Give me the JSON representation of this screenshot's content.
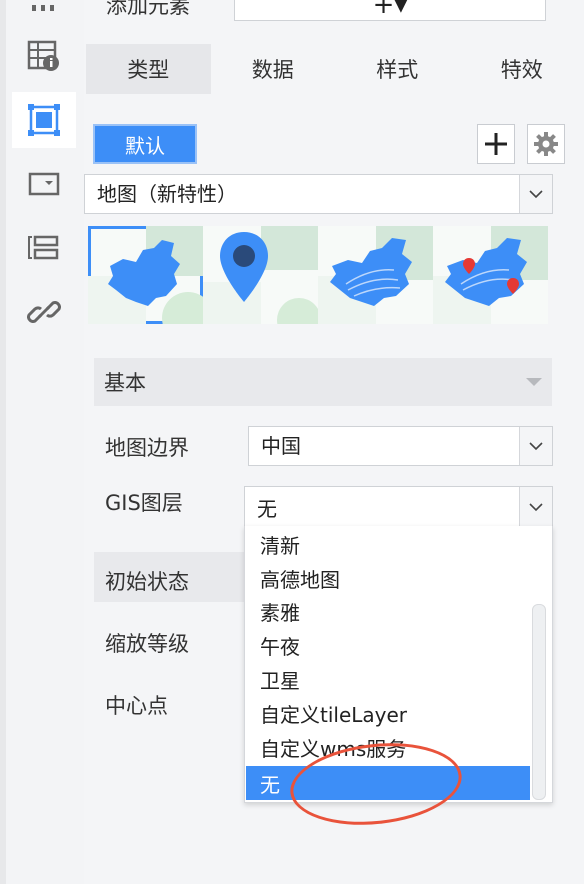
{
  "rail": {
    "items": [
      {
        "icon": "menu-icon"
      },
      {
        "icon": "table-info-icon"
      },
      {
        "icon": "frame-select-icon",
        "active": true
      },
      {
        "icon": "dropdown-widget-icon"
      },
      {
        "icon": "layer-list-icon"
      },
      {
        "icon": "link-icon"
      }
    ]
  },
  "header": {
    "title": "添加元素",
    "add_symbol": "+▾"
  },
  "tabs": [
    "类型",
    "数据",
    "样式",
    "特效"
  ],
  "type_row": {
    "default_label": "默认",
    "add_icon": "plus-icon",
    "settings_icon": "gear-icon"
  },
  "chart_type": {
    "value": "地图（新特性）"
  },
  "section": {
    "basic": "基本"
  },
  "fields": {
    "map_boundary_label": "地图边界",
    "map_boundary_value": "中国",
    "gis_layer_label": "GIS图层",
    "gis_layer_value": "无",
    "initial_state_label": "初始状态",
    "zoom_level_label": "缩放等级",
    "center_label": "中心点"
  },
  "gis_options": [
    "清新",
    "高德地图",
    "素雅",
    "午夜",
    "卫星",
    "自定义tileLayer",
    "自定义wms服务",
    "无"
  ],
  "gis_selected_index": 7,
  "colors": {
    "accent": "#3d8ef7",
    "annotation": "#e9533b"
  }
}
